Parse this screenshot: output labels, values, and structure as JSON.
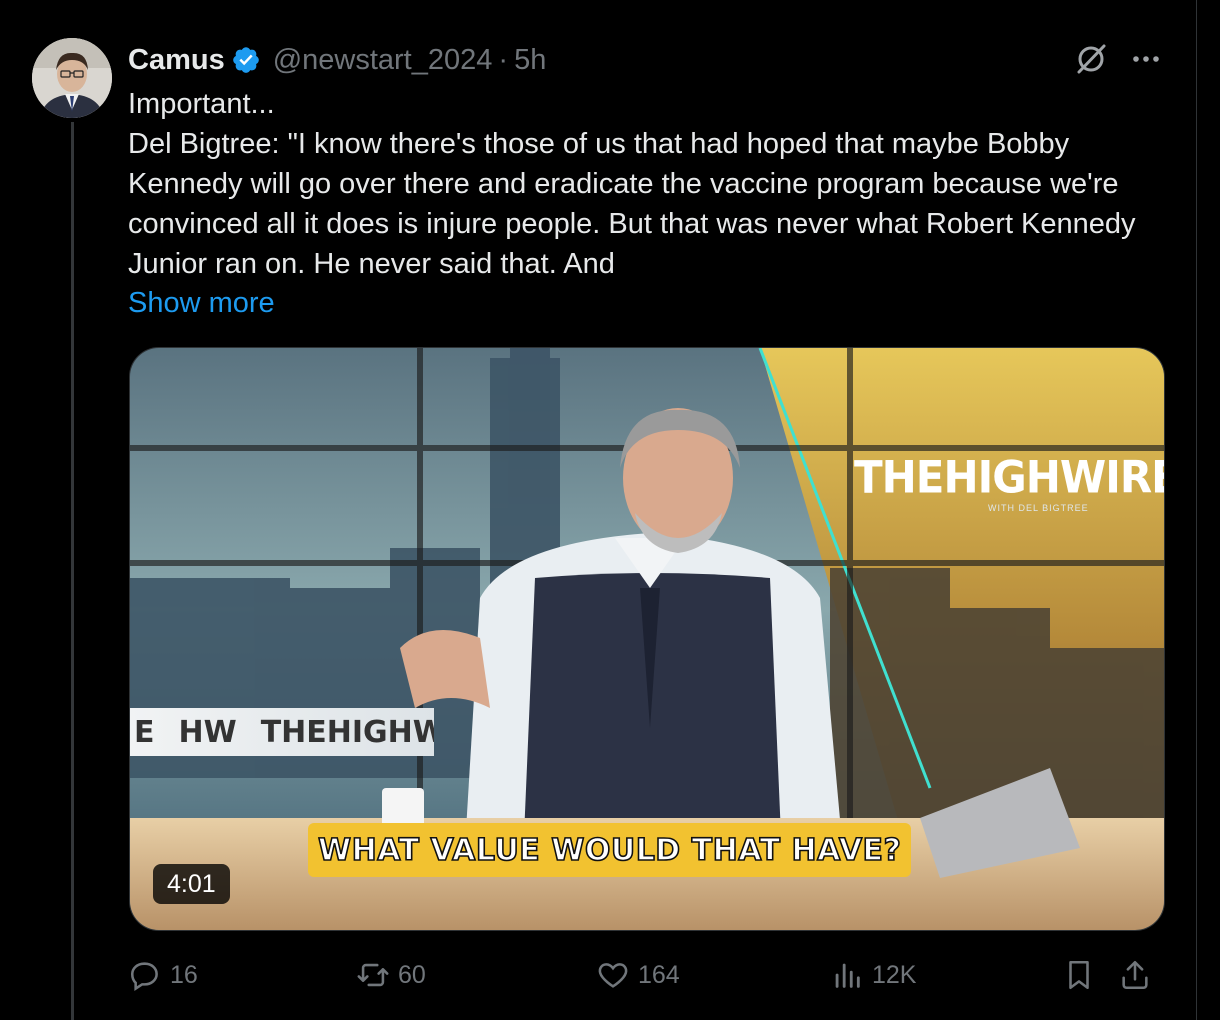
{
  "post": {
    "author_name": "Camus",
    "handle": "@newstart_2024",
    "separator": "·",
    "time": "5h",
    "text_lines": [
      "Important...",
      "Del Bigtree: \"I know there's those of us that had hoped that maybe Bobby Kennedy will go over there and eradicate the vaccine program because we're convinced all it does is injure people. But that was never what Robert Kennedy Junior ran on. He never said that. And"
    ],
    "show_more": "Show more"
  },
  "video": {
    "caption": "WHAT VALUE WOULD THAT HAVE?",
    "logo_text": "THEHIGHWIRE",
    "logo_subtext": "WITH DEL BIGTREE",
    "banner_text_1": "E",
    "banner_text_2": "HW",
    "banner_text_3": "THEHIGHWIRI",
    "duration": "4:01"
  },
  "actions": {
    "replies": "16",
    "reposts": "60",
    "likes": "164",
    "views": "12K"
  },
  "icons": [
    "verified-badge-icon",
    "grok-icon",
    "more-icon",
    "reply-icon",
    "repost-icon",
    "like-icon",
    "views-icon",
    "bookmark-icon",
    "share-icon"
  ],
  "colors": {
    "background": "#000000",
    "text": "#e7e9ea",
    "muted": "#71767b",
    "link": "#1d9bf0",
    "verified": "#1d9bf0",
    "caption_bg": "#f2c230"
  }
}
